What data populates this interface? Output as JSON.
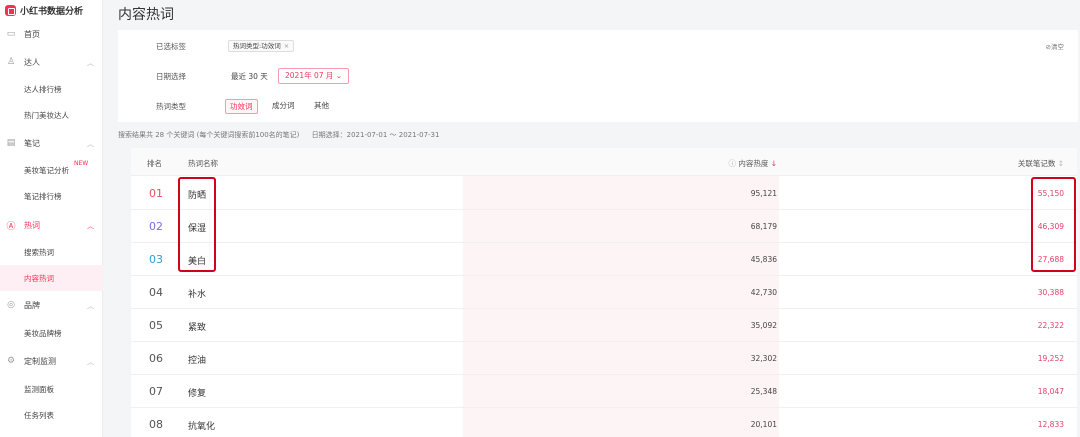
{
  "sidebar": {
    "brand": "小红书数据分析",
    "home": "首页",
    "groups": {
      "daren": "达人",
      "notes": "笔记",
      "hotwords": "热词",
      "brand": "品牌",
      "monitor": "定制监测"
    },
    "items": {
      "daren_rank": "达人排行榜",
      "beauty_daren": "热门美妆达人",
      "beauty_note_analysis": "美妆笔记分析",
      "new_badge": "NEW",
      "note_rank": "笔记排行榜",
      "search_words": "搜索热词",
      "content_words": "内容热词",
      "beauty_brand_rank": "美妆品牌榜",
      "monitor_board": "监测面板",
      "task_list": "任务列表"
    }
  },
  "page": {
    "title": "内容热词"
  },
  "filter": {
    "selected_label": "已选标签",
    "selected_tag": "热词类型:功效词",
    "tag_close": "×",
    "clear": "清空",
    "date_label": "日期选择",
    "recent_30": "最近 30 天",
    "month_value": "2021年 07 月",
    "type_label": "热词类型",
    "types": [
      "功效词",
      "成分词",
      "其他"
    ]
  },
  "summary": {
    "text": "搜索结果共 28 个关键词 (每个关键词搜索前100名的笔记)",
    "range": "日期选择：2021-07-01 ～ 2021-07-31"
  },
  "table": {
    "headers": {
      "rank": "排名",
      "word": "热词名称",
      "heat": "内容热度",
      "notes": "关联笔记数"
    },
    "rows": [
      {
        "rank": "01",
        "word": "防晒",
        "heat": "95,121",
        "notes": "55,150"
      },
      {
        "rank": "02",
        "word": "保湿",
        "heat": "68,179",
        "notes": "46,309"
      },
      {
        "rank": "03",
        "word": "美白",
        "heat": "45,836",
        "notes": "27,688"
      },
      {
        "rank": "04",
        "word": "补水",
        "heat": "42,730",
        "notes": "30,388"
      },
      {
        "rank": "05",
        "word": "紧致",
        "heat": "35,092",
        "notes": "22,322"
      },
      {
        "rank": "06",
        "word": "控油",
        "heat": "32,302",
        "notes": "19,252"
      },
      {
        "rank": "07",
        "word": "修复",
        "heat": "25,348",
        "notes": "18,047"
      },
      {
        "rank": "08",
        "word": "抗氧化",
        "heat": "20,101",
        "notes": "12,833"
      }
    ]
  },
  "colors": {
    "accent": "#ff2d55",
    "rank1": "#e8505b",
    "rank2": "#7a6fd6",
    "rank3": "#2f9fd6",
    "highlight": "#d0021b"
  }
}
